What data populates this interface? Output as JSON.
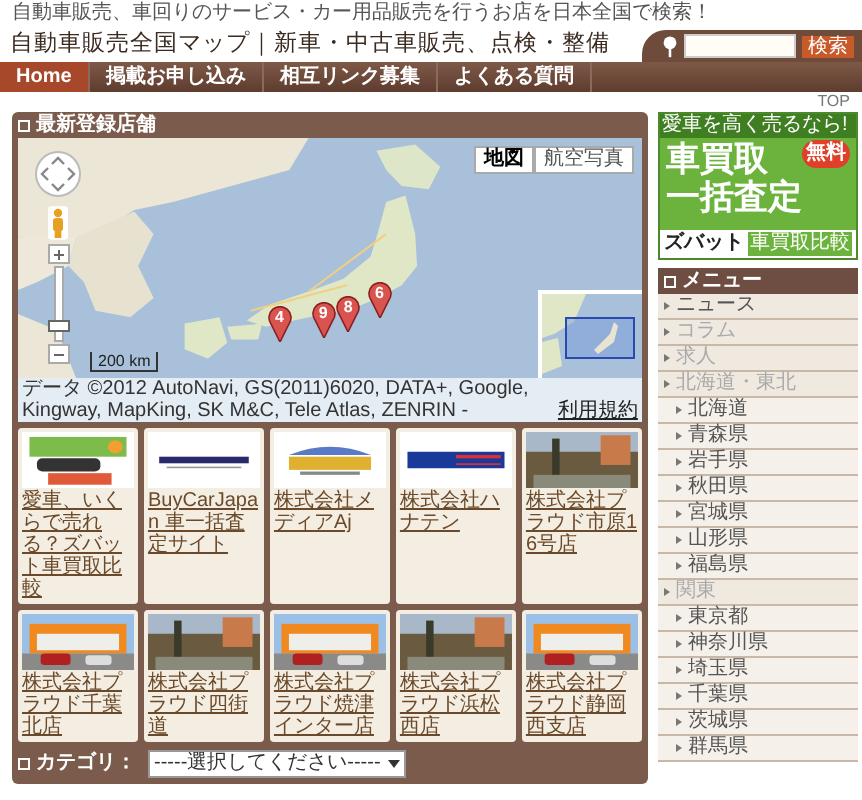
{
  "tagline": "自動車販売、車回りのサービス・カー用品販売を行うお店を日本全国で検索！",
  "site_title": "自動車販売全国マップ｜新車・中古車販売、点検・整備",
  "search": {
    "button": "検索"
  },
  "nav": [
    {
      "label": "Home",
      "selected": true
    },
    {
      "label": "掲載お申し込み",
      "selected": false
    },
    {
      "label": "相互リンク募集",
      "selected": false
    },
    {
      "label": "よくある質問",
      "selected": false
    }
  ],
  "top_link": "TOP",
  "section_title": "最新登録店舗",
  "map": {
    "types": [
      {
        "label": "地図",
        "selected": true
      },
      {
        "label": "航空写真",
        "selected": false
      }
    ],
    "zoom": {
      "level": 0.2
    },
    "markers": [
      {
        "label": "4"
      },
      {
        "label": "9"
      },
      {
        "label": "8"
      },
      {
        "label": "6"
      }
    ],
    "scale": "200 km",
    "attribution": "データ ©2012 AutoNavi, GS(2011)6020, DATA+, Google, Kingway, MapKing, SK M&C, Tele Atlas, ZENRIN -",
    "terms": "利用規約"
  },
  "shops": [
    {
      "caption": "愛車、いくらで売れる？ズバット車買取比較"
    },
    {
      "caption": "BuyCarJapan 車一括査定サイト"
    },
    {
      "caption": "株式会社メディアAj"
    },
    {
      "caption": "株式会社ハナテン"
    },
    {
      "caption": "株式会社プラウド市原16号店"
    },
    {
      "caption": "株式会社プラウド千葉北店"
    },
    {
      "caption": "株式会社プラウド四街道"
    },
    {
      "caption": "株式会社プラウド焼津インター店"
    },
    {
      "caption": "株式会社プラウド浜松西店"
    },
    {
      "caption": "株式会社プラウド静岡西支店"
    }
  ],
  "category": {
    "label": "カテゴリ：",
    "value": "-----選択してください-----"
  },
  "ad": {
    "headline": "愛車を高く売るなら!",
    "line1": "車買取",
    "line2": "一括査定",
    "badge": "無料",
    "brand": "ズバット",
    "tag": "車買取比較"
  },
  "menu": {
    "title": "メニュー",
    "items": [
      {
        "label": "ニュース",
        "dimmed": false
      },
      {
        "label": "コラム",
        "dimmed": true
      },
      {
        "label": "求人",
        "dimmed": true
      },
      {
        "label": "北海道・東北",
        "dimmed": true,
        "children": [
          {
            "label": "北海道"
          },
          {
            "label": "青森県"
          },
          {
            "label": "岩手県"
          },
          {
            "label": "秋田県"
          },
          {
            "label": "宮城県"
          },
          {
            "label": "山形県"
          },
          {
            "label": "福島県"
          }
        ]
      },
      {
        "label": "関東",
        "dimmed": true,
        "children": [
          {
            "label": "東京都"
          },
          {
            "label": "神奈川県"
          },
          {
            "label": "埼玉県"
          },
          {
            "label": "千葉県"
          },
          {
            "label": "茨城県"
          },
          {
            "label": "群馬県"
          }
        ]
      }
    ]
  }
}
